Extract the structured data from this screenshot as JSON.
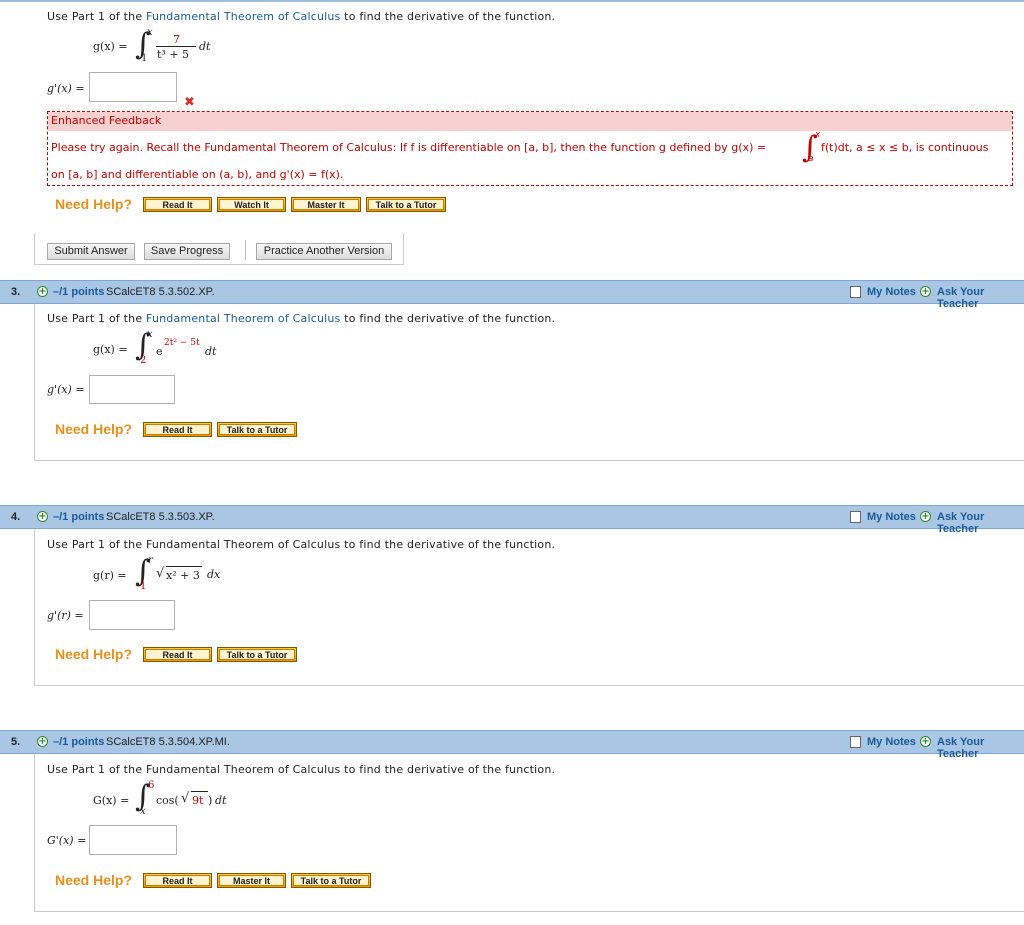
{
  "q2": {
    "prompt_a": "Use Part 1 of the ",
    "prompt_link": "Fundamental Theorem of Calculus",
    "prompt_b": " to find the derivative of the function.",
    "lhs": "g(x) =",
    "upper": "x",
    "lower": "1",
    "numerator": "7",
    "denominator": "t³ + 5",
    "differential": "dt",
    "answer_label": "g'(x) =",
    "answer_value": "",
    "wrong_mark": "✖",
    "feedback": {
      "title": "Enhanced Feedback",
      "line1": "Please try again. Recall the Fundamental Theorem of Calculus: If f is differentiable on  [a, b],  then the function g defined by  g(x) =",
      "line1_integrand": "f(t)dt,  a ≤ x ≤ b,  is continuous",
      "upper": "x",
      "lower": "a",
      "line2": "on  [a, b]  and differentiable on  (a, b),  and  g'(x) = f(x)."
    },
    "need_help": "Need Help?",
    "buttons": [
      "Read It",
      "Watch It",
      "Master It",
      "Talk to a Tutor"
    ]
  },
  "actions": {
    "submit": "Submit Answer",
    "save": "Save Progress",
    "practice": "Practice Another Version"
  },
  "q3": {
    "number": "3.",
    "points": "–/1 points",
    "code": "SCalcET8 5.3.502.XP.",
    "my_notes": "My Notes",
    "ask": "Ask Your Teacher",
    "prompt_a": "Use Part 1 of the ",
    "prompt_link": "Fundamental Theorem of Calculus",
    "prompt_b": " to find the derivative of the function.",
    "lhs": "g(x) =",
    "upper": "x",
    "lower": "2",
    "integrand": "e",
    "exponent": "2t² − 5t",
    "differential": "dt",
    "answer_label": "g'(x) =",
    "need_help": "Need Help?",
    "buttons": [
      "Read It",
      "Talk to a Tutor"
    ]
  },
  "q4": {
    "number": "4.",
    "points": "–/1 points",
    "code": "SCalcET8 5.3.503.XP.",
    "my_notes": "My Notes",
    "ask": "Ask Your Teacher",
    "prompt": "Use Part 1 of the Fundamental Theorem of Calculus to find the derivative of the function.",
    "lhs": "g(r) =",
    "upper": "r",
    "lower": "1",
    "radicand": "x² + 3",
    "differential": "dx",
    "answer_label": "g'(r) =",
    "need_help": "Need Help?",
    "buttons": [
      "Read It",
      "Talk to a Tutor"
    ]
  },
  "q5": {
    "number": "5.",
    "points": "–/1 points",
    "code": "SCalcET8 5.3.504.XP.MI.",
    "my_notes": "My Notes",
    "ask": "Ask Your Teacher",
    "prompt": "Use Part 1 of the Fundamental Theorem of Calculus to find the derivative of the function.",
    "lhs": "G(x) =",
    "upper": "6",
    "lower": "x",
    "func": "cos(",
    "radicand": "9t",
    "func_close": ")",
    "differential": "dt",
    "answer_label": "G'(x) =",
    "need_help": "Need Help?",
    "buttons": [
      "Read It",
      "Master It",
      "Talk to a Tutor"
    ]
  }
}
